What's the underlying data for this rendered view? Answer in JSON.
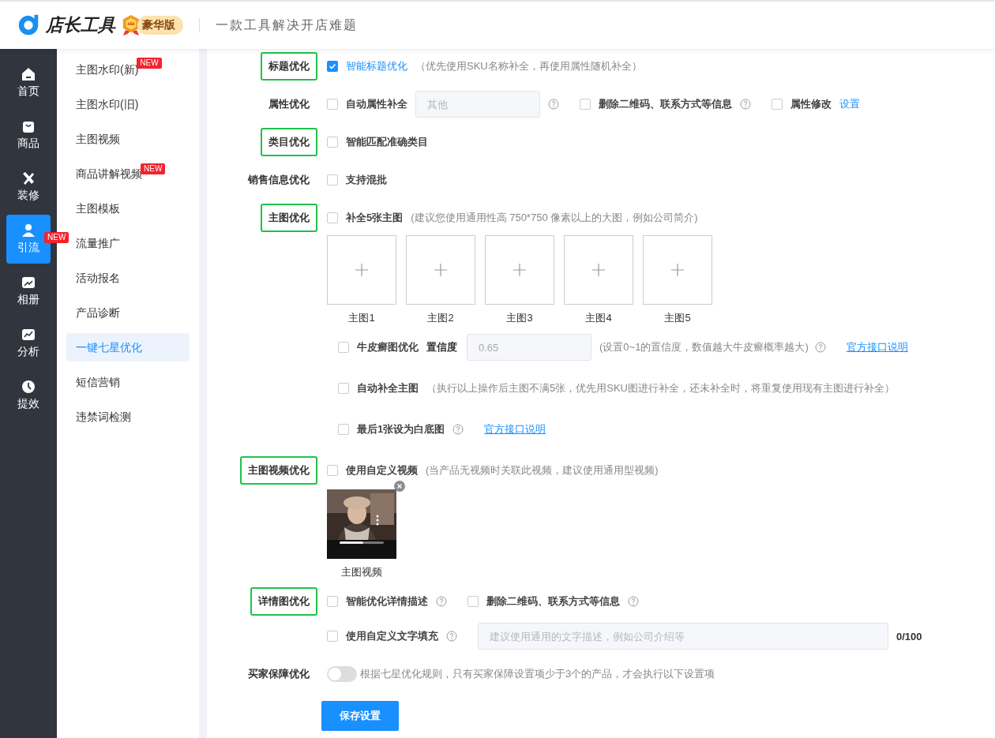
{
  "header": {
    "logo_text": "店长工具",
    "badge": "豪华版",
    "slogan": "一款工具解决开店难题"
  },
  "nav": [
    {
      "label": "首页",
      "selected": false
    },
    {
      "label": "商品",
      "selected": false
    },
    {
      "label": "装修",
      "selected": false
    },
    {
      "label": "引流",
      "selected": true,
      "badge": "NEW"
    },
    {
      "label": "相册",
      "selected": false
    },
    {
      "label": "分析",
      "selected": false
    },
    {
      "label": "提效",
      "selected": false
    }
  ],
  "submenu": [
    {
      "label": "主图水印(新)",
      "selected": false,
      "badge": "NEW"
    },
    {
      "label": "主图水印(旧)",
      "selected": false
    },
    {
      "label": "主图视频",
      "selected": false
    },
    {
      "label": "商品讲解视频",
      "selected": false,
      "badge": "NEW"
    },
    {
      "label": "主图模板",
      "selected": false
    },
    {
      "label": "流量推广",
      "selected": false
    },
    {
      "label": "活动报名",
      "selected": false
    },
    {
      "label": "产品诊断",
      "selected": false
    },
    {
      "label": "一键七星优化",
      "selected": true
    },
    {
      "label": "短信营销",
      "selected": false
    },
    {
      "label": "违禁词检测",
      "selected": false
    }
  ],
  "rows": [
    {
      "label": "标题优化",
      "highlighted": true,
      "lines": [
        [
          {
            "kind": "checkbox",
            "label": "智能标题优化",
            "checked": true
          },
          {
            "kind": "note",
            "text": "（优先使用SKU名称补全，再使用属性随机补全）"
          }
        ]
      ]
    },
    {
      "label": "属性优化",
      "highlighted": false,
      "lines": [
        [
          {
            "kind": "checkbox",
            "label": "自动属性补全",
            "checked": false
          },
          {
            "kind": "input",
            "placeholder": "其他"
          },
          {
            "kind": "help"
          },
          {
            "kind": "checkbox",
            "label": "删除二维码、联系方式等信息",
            "checked": false
          },
          {
            "kind": "help"
          },
          {
            "kind": "checkbox",
            "label": "属性修改",
            "checked": false
          },
          {
            "kind": "link",
            "text": "设置",
            "underline": false
          }
        ]
      ]
    },
    {
      "label": "类目优化",
      "highlighted": true,
      "lines": [
        [
          {
            "kind": "checkbox",
            "label": "智能匹配准确类目",
            "checked": false
          }
        ]
      ]
    },
    {
      "label": "销售信息优化",
      "highlighted": false,
      "lines": [
        [
          {
            "kind": "checkbox",
            "label": "支持混批",
            "checked": false
          }
        ]
      ]
    },
    {
      "label": "主图优化",
      "highlighted": true,
      "lines": [
        [
          {
            "kind": "checkbox",
            "label": "补全5张主图",
            "checked": false
          },
          {
            "kind": "note",
            "text": "(建议您使用通用性高 750*750 像素以上的大图，例如公司简介)"
          }
        ],
        [
          {
            "kind": "uploads",
            "slots": [
              {
                "caption": "主图1"
              },
              {
                "caption": "主图2"
              },
              {
                "caption": "主图3"
              },
              {
                "caption": "主图4"
              },
              {
                "caption": "主图5"
              }
            ]
          }
        ]
      ],
      "options": [
        [
          {
            "kind": "checkbox",
            "label": "牛皮癣图优化",
            "checked": false
          },
          {
            "kind": "text",
            "text": "置信度"
          },
          {
            "kind": "input",
            "value": "0.65"
          },
          {
            "kind": "note",
            "text": "(设置0~1的置信度，数值越大牛皮癣概率越大)"
          },
          {
            "kind": "help"
          },
          {
            "kind": "link",
            "text": "官方接口说明",
            "underline": true
          }
        ],
        [
          {
            "kind": "checkbox",
            "label": "自动补全主图",
            "checked": false
          },
          {
            "kind": "note",
            "text": "（执行以上操作后主图不满5张，优先用SKU图进行补全，还未补全时，将重复使用现有主图进行补全）"
          }
        ],
        [
          {
            "kind": "checkbox",
            "label": "最后1张设为白底图",
            "checked": false
          },
          {
            "kind": "help"
          },
          {
            "kind": "link",
            "text": "官方接口说明",
            "underline": true
          }
        ]
      ]
    },
    {
      "label": "主图视频优化",
      "highlighted": true,
      "lines": [
        [
          {
            "kind": "checkbox",
            "label": "使用自定义视频",
            "checked": false
          },
          {
            "kind": "note",
            "text": "(当产品无视频时关联此视频，建议使用通用型视频)"
          }
        ],
        [
          {
            "kind": "video",
            "caption": "主图视频"
          }
        ]
      ]
    },
    {
      "label": "详情图优化",
      "highlighted": true,
      "lines": [
        [
          {
            "kind": "checkbox",
            "label": "智能优化详情描述",
            "checked": false
          },
          {
            "kind": "help"
          },
          {
            "kind": "checkbox",
            "label": "删除二维码、联系方式等信息",
            "checked": false
          },
          {
            "kind": "help"
          }
        ],
        [
          {
            "kind": "checkbox",
            "label": "使用自定义文字填充",
            "checked": false
          },
          {
            "kind": "help"
          },
          {
            "kind": "input",
            "placeholder": "建议使用通用的文字描述，例如公司介绍等",
            "wide": true
          },
          {
            "kind": "text",
            "text": "0/100"
          }
        ]
      ]
    },
    {
      "label": "买家保障优化",
      "highlighted": false,
      "lines": [
        [
          {
            "kind": "toggle",
            "on": false
          },
          {
            "kind": "note",
            "text": "根据七星优化规则，只有买家保障设置项少于3个的产品，才会执行以下设置项"
          }
        ]
      ]
    }
  ],
  "save_button": "保存设置"
}
